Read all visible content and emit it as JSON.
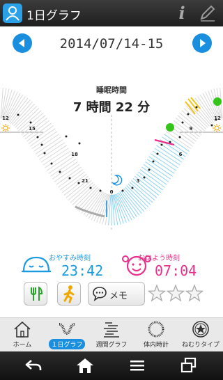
{
  "app": {
    "title": "1日グラフ"
  },
  "date_nav": {
    "date": "2014/07/14-15"
  },
  "graph": {
    "sleep_label": "睡眠時間",
    "sleep_duration": "7 時間 22 分",
    "hour_labels": [
      "12",
      "15",
      "18",
      "21",
      "0",
      "3",
      "6",
      "9",
      "12"
    ]
  },
  "bedtime": {
    "label": "おやすみ時刻",
    "time": "23:42"
  },
  "wakeup": {
    "label": "おはよう時刻",
    "time": "07:04"
  },
  "actions": {
    "memo_label": "メモ",
    "rating_stars": 3,
    "rating_value": 0
  },
  "tabs": [
    {
      "label": "ホーム",
      "icon": "home-icon"
    },
    {
      "label": "１日グラフ",
      "icon": "day-graph-icon"
    },
    {
      "label": "週間グラフ",
      "icon": "weekly-graph-icon"
    },
    {
      "label": "体内時計",
      "icon": "body-clock-icon"
    },
    {
      "label": "ねむりタイプ",
      "icon": "sleep-type-icon"
    }
  ],
  "colors": {
    "accent": "#1a8fe0",
    "sleep": "#8fd3ef",
    "wake": "#e8308a",
    "event_green": "#34c41a",
    "event_yellow": "#f0c419",
    "bed_line": "#aaaaaa"
  }
}
